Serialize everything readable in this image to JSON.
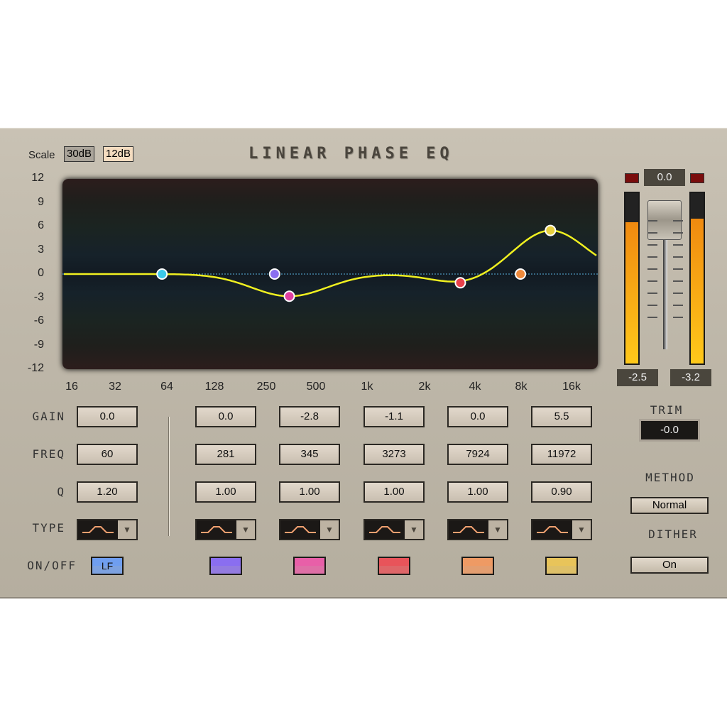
{
  "title": "LINEAR PHASE EQ",
  "scale": {
    "label": "Scale",
    "options": [
      "30dB",
      "12dB"
    ],
    "selected": "12dB"
  },
  "y_ticks": [
    "12",
    "9",
    "6",
    "3",
    "0",
    "-3",
    "-6",
    "-9",
    "-12"
  ],
  "x_ticks": [
    "16",
    "32",
    "64",
    "128",
    "250",
    "500",
    "1k",
    "2k",
    "4k",
    "8k",
    "16k"
  ],
  "row_labels": {
    "gain": "GAIN",
    "freq": "FREQ",
    "q": "Q",
    "type": "TYPE",
    "onoff": "ON/OFF"
  },
  "bands": [
    {
      "gain": "0.0",
      "freq": "60",
      "q": "1.20",
      "on_label": "LF",
      "color": "#6f9ef0"
    },
    {
      "gain": "0.0",
      "freq": "281",
      "q": "1.00",
      "on_label": "",
      "color": "#8a6ef0"
    },
    {
      "gain": "-2.8",
      "freq": "345",
      "q": "1.00",
      "on_label": "",
      "color": "#e85fa8"
    },
    {
      "gain": "-1.1",
      "freq": "3273",
      "q": "1.00",
      "on_label": "",
      "color": "#e8545a"
    },
    {
      "gain": "0.0",
      "freq": "7924",
      "q": "1.00",
      "on_label": "",
      "color": "#ee9a64"
    },
    {
      "gain": "5.5",
      "freq": "11972",
      "q": "0.90",
      "on_label": "",
      "color": "#e8c45a"
    }
  ],
  "nodes": [
    {
      "freq": 60,
      "gain": 0.0,
      "color": "#3cc8e8"
    },
    {
      "freq": 281,
      "gain": 0.0,
      "color": "#8a6ef0"
    },
    {
      "freq": 345,
      "gain": -2.8,
      "color": "#e040a0"
    },
    {
      "freq": 3273,
      "gain": -1.1,
      "color": "#e8404a"
    },
    {
      "freq": 7924,
      "gain": 0.0,
      "color": "#ee8a3c"
    },
    {
      "freq": 11972,
      "gain": 5.5,
      "color": "#e8d040"
    }
  ],
  "output": {
    "fader_value": "0.0",
    "left_level": "-2.5",
    "right_level": "-3.2",
    "left_fill_pct": 83,
    "right_fill_pct": 85
  },
  "trim": {
    "label": "TRIM",
    "value": "-0.0"
  },
  "method": {
    "label": "METHOD",
    "value": "Normal"
  },
  "dither": {
    "label": "DITHER",
    "value": "On"
  },
  "colors": {
    "curve": "#f0f020",
    "zero_line": "#5ab4e0"
  }
}
